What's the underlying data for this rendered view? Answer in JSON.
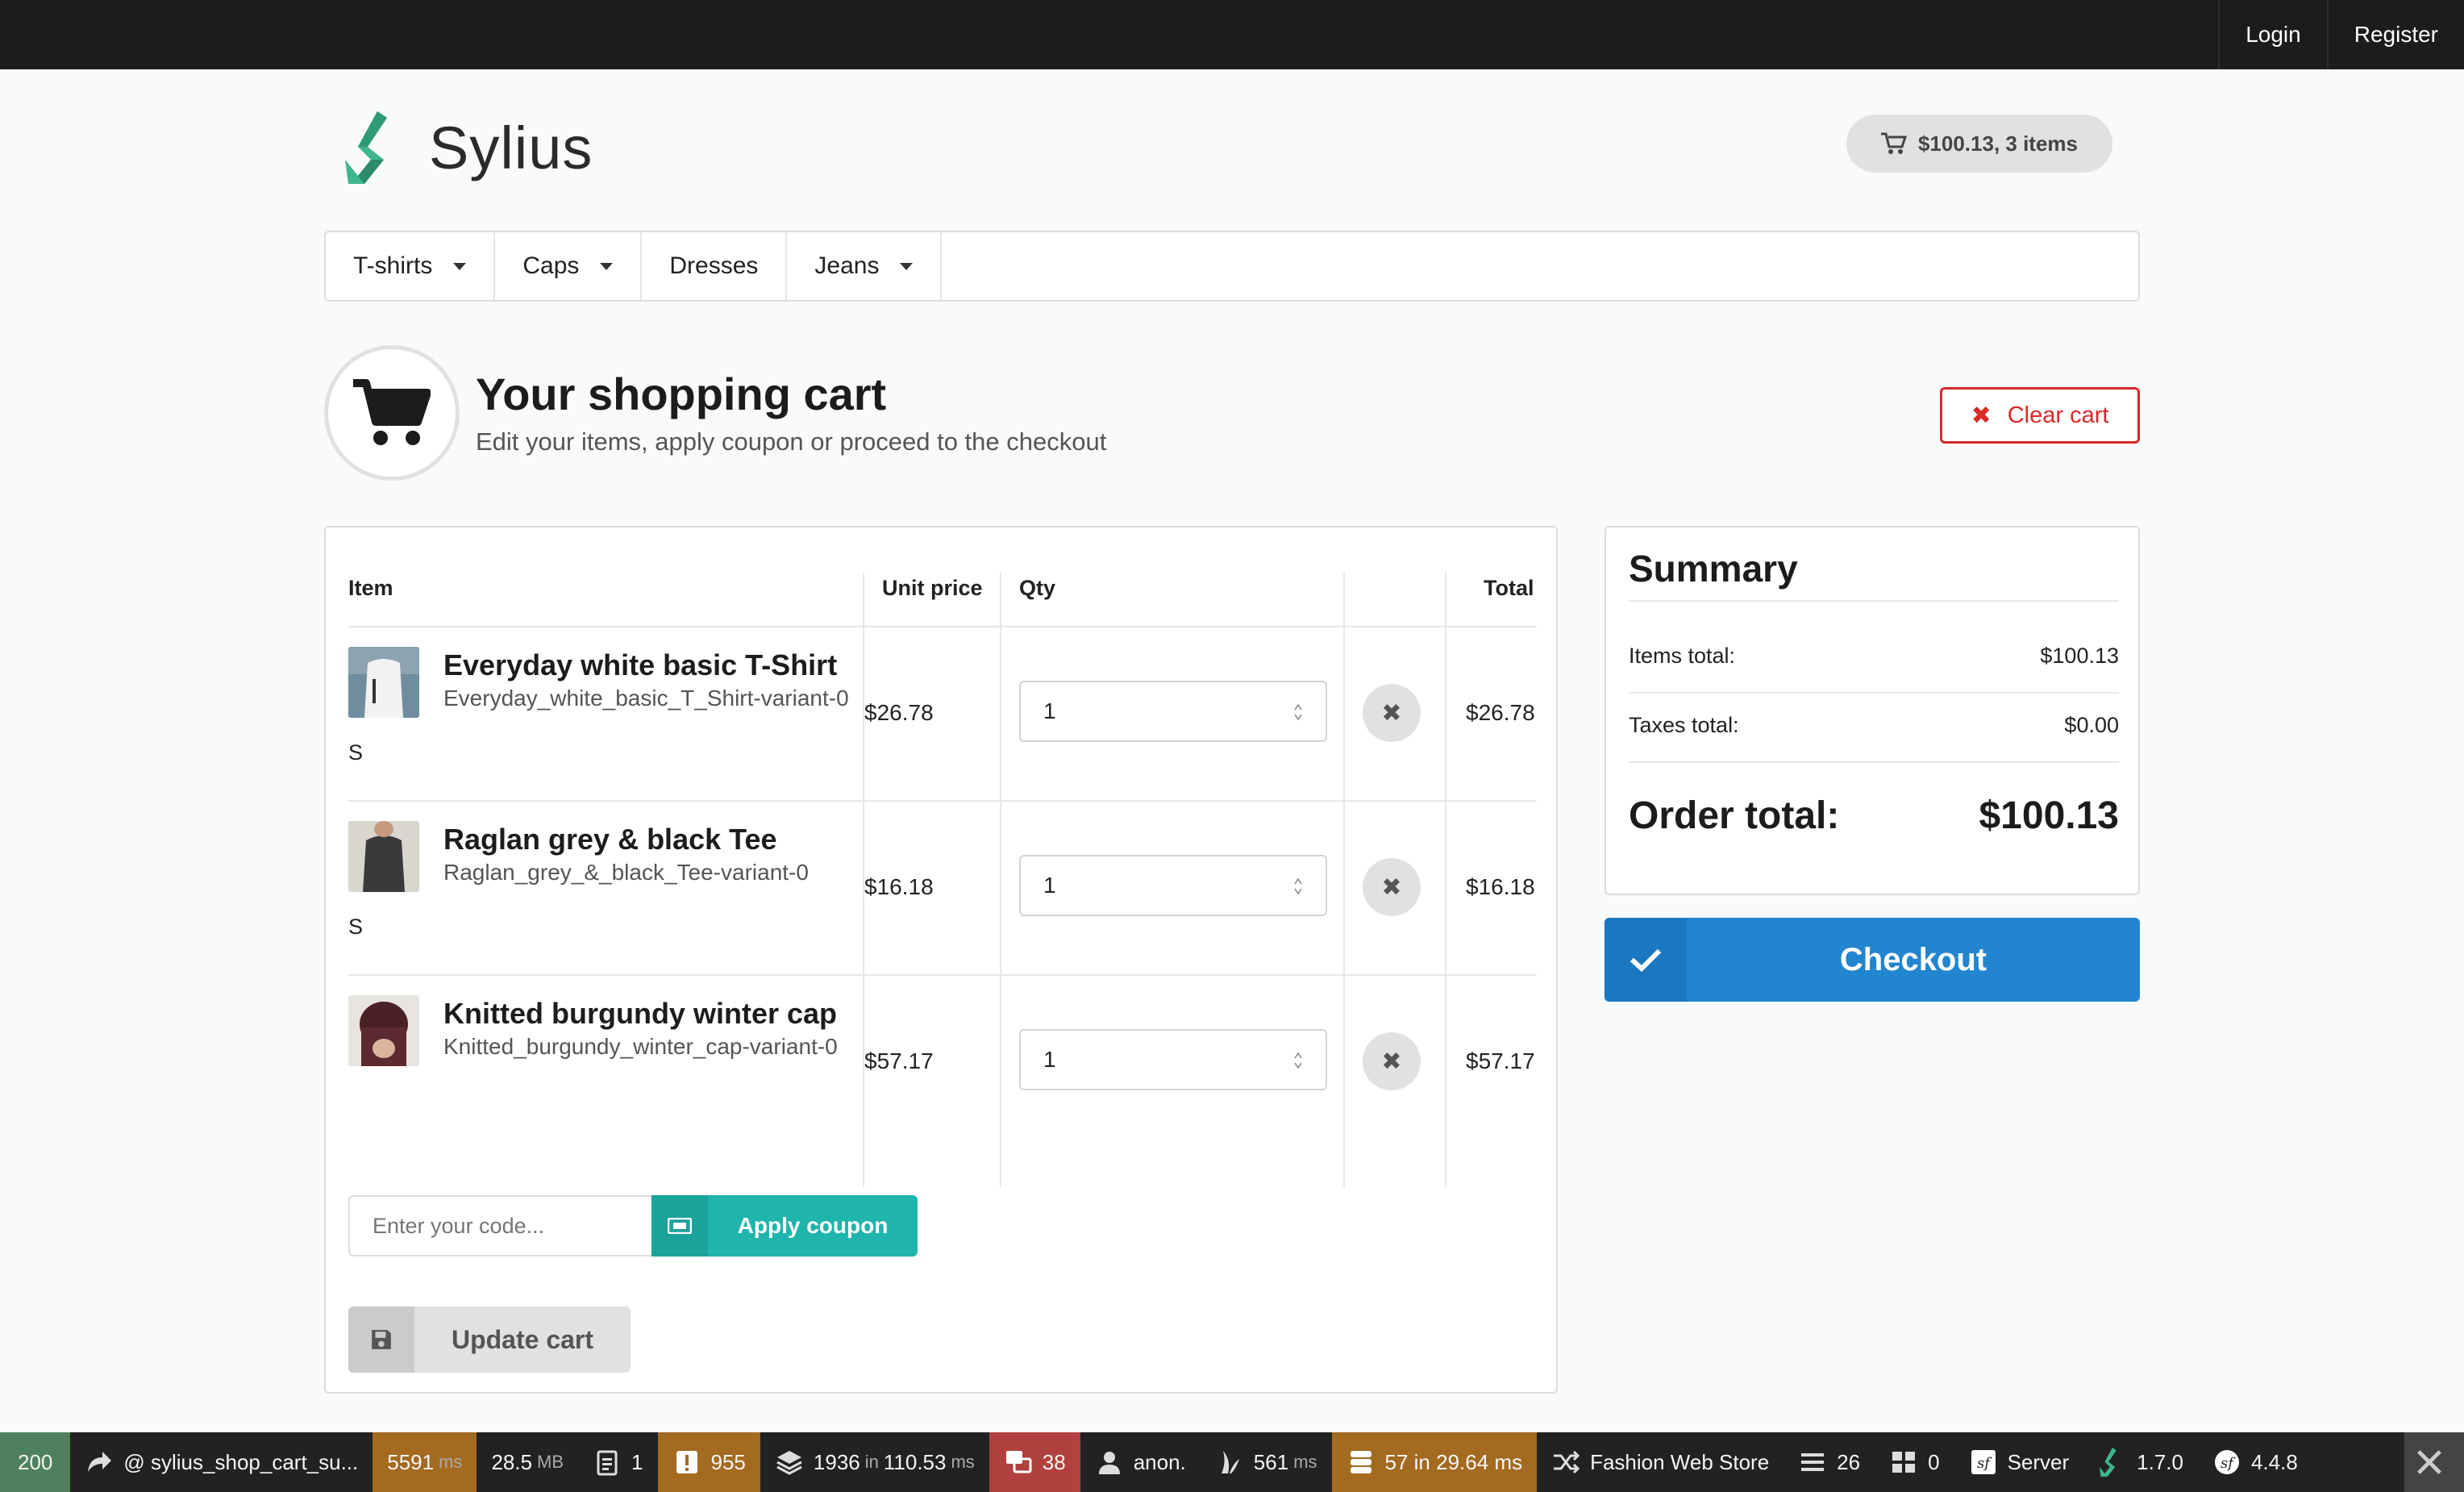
{
  "topbar": {
    "links": [
      "Login",
      "Register"
    ]
  },
  "brand": {
    "name": "Sylius",
    "accent": "#3fb68e"
  },
  "header": {
    "cart_summary": "$100.13, 3 items"
  },
  "menu": {
    "items": [
      {
        "label": "T-shirts",
        "dropdown": true
      },
      {
        "label": "Caps",
        "dropdown": true
      },
      {
        "label": "Dresses",
        "dropdown": false
      },
      {
        "label": "Jeans",
        "dropdown": true
      }
    ]
  },
  "page": {
    "title": "Your shopping cart",
    "subtitle": "Edit your items, apply coupon or proceed to the checkout",
    "clear_label": "Clear cart"
  },
  "cart": {
    "columns": {
      "item": "Item",
      "unit_price": "Unit price",
      "qty": "Qty",
      "total": "Total"
    },
    "rows": [
      {
        "name": "Everyday white basic T-Shirt",
        "variant": "Everyday_white_basic_T_Shirt-variant-0",
        "size": "S",
        "unit_price": "$26.78",
        "qty": "1",
        "total": "$26.78"
      },
      {
        "name": "Raglan grey & black Tee",
        "variant": "Raglan_grey_&_black_Tee-variant-0",
        "size": "S",
        "unit_price": "$16.18",
        "qty": "1",
        "total": "$16.18"
      },
      {
        "name": "Knitted burgundy winter cap",
        "variant": "Knitted_burgundy_winter_cap-variant-0",
        "size": "",
        "unit_price": "$57.17",
        "qty": "1",
        "total": "$57.17"
      }
    ],
    "coupon_placeholder": "Enter your code...",
    "apply_coupon_label": "Apply coupon",
    "update_label": "Update cart"
  },
  "summary": {
    "title": "Summary",
    "items_total_label": "Items total:",
    "items_total_value": "$100.13",
    "taxes_total_label": "Taxes total:",
    "taxes_total_value": "$0.00",
    "order_total_label": "Order total:",
    "order_total_value": "$100.13",
    "checkout_label": "Checkout"
  },
  "debug": {
    "status": "200",
    "route": "@ sylius_shop_cart_su...",
    "time": "5591",
    "time_unit": "ms",
    "memory": "28.5",
    "memory_unit": "MB",
    "forms": "1",
    "logs": "955",
    "events": "1936",
    "events_in": "in",
    "events_time": "110.53",
    "events_unit": "ms",
    "translations": "38",
    "user": "anon.",
    "render": "561",
    "render_unit": "ms",
    "db": "57 in 29.64 ms",
    "channel": "Fashion Web Store",
    "config": "26",
    "twig": "0",
    "server": "Server",
    "sylius_version": "1.7.0",
    "symfony_version": "4.4.8"
  }
}
